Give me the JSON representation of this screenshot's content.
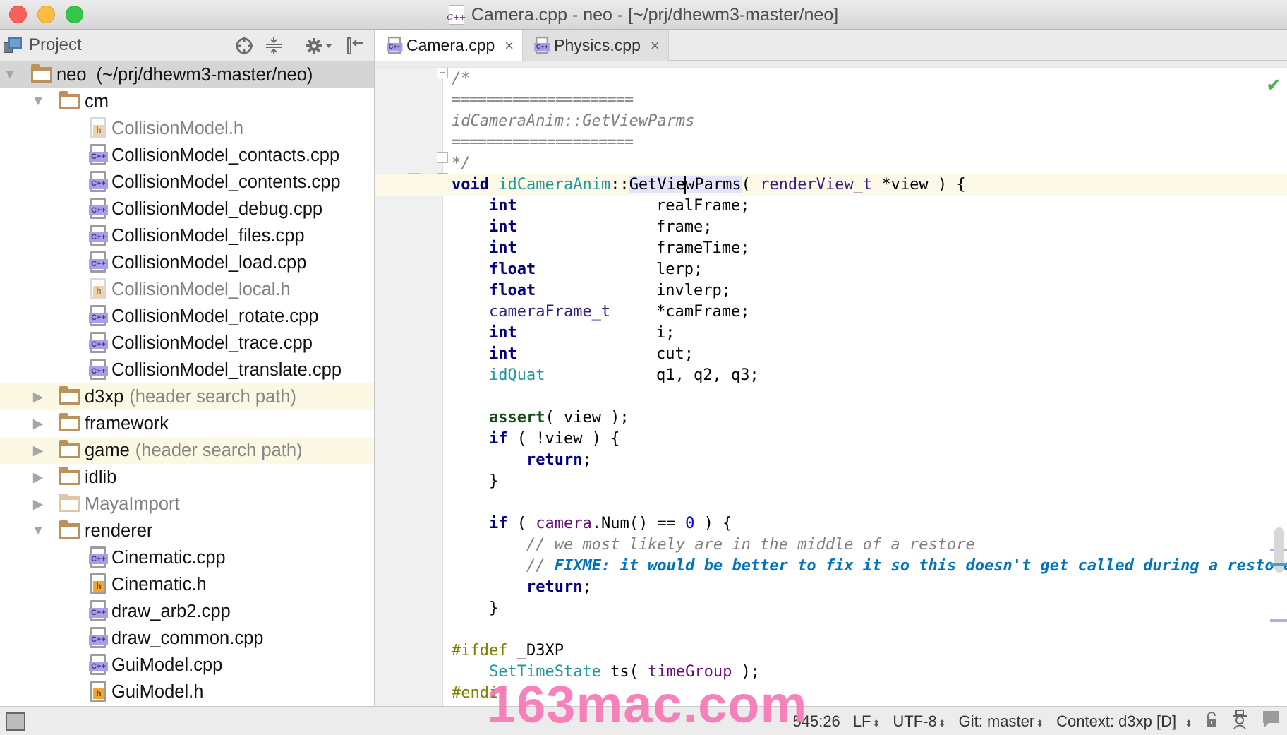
{
  "window": {
    "title": "Camera.cpp - neo - [~/prj/dhewm3-master/neo]",
    "title_icon": "cpp-file-icon"
  },
  "project_panel": {
    "title": "Project",
    "tools": [
      "locate-icon",
      "collapse-all-icon",
      "gear-icon",
      "hide-panel-icon"
    ],
    "tree": [
      {
        "label": "neo",
        "hint": "(~/prj/dhewm3-master/neo)",
        "type": "folder",
        "expanded": true,
        "selected": true
      },
      {
        "label": "cm",
        "type": "folder",
        "expanded": true
      },
      {
        "label": "CollisionModel.h",
        "type": "h",
        "dim": true
      },
      {
        "label": "CollisionModel_contacts.cpp",
        "type": "cpp"
      },
      {
        "label": "CollisionModel_contents.cpp",
        "type": "cpp"
      },
      {
        "label": "CollisionModel_debug.cpp",
        "type": "cpp"
      },
      {
        "label": "CollisionModel_files.cpp",
        "type": "cpp"
      },
      {
        "label": "CollisionModel_load.cpp",
        "type": "cpp"
      },
      {
        "label": "CollisionModel_local.h",
        "type": "h",
        "dim": true
      },
      {
        "label": "CollisionModel_rotate.cpp",
        "type": "cpp"
      },
      {
        "label": "CollisionModel_trace.cpp",
        "type": "cpp"
      },
      {
        "label": "CollisionModel_translate.cpp",
        "type": "cpp"
      },
      {
        "label": "d3xp",
        "hint": "(header search path)",
        "type": "folder",
        "expanded": false
      },
      {
        "label": "framework",
        "type": "folder",
        "expanded": false
      },
      {
        "label": "game",
        "hint": "(header search path)",
        "type": "folder",
        "expanded": false
      },
      {
        "label": "idlib",
        "type": "folder",
        "expanded": false
      },
      {
        "label": "MayaImport",
        "type": "folder",
        "expanded": false,
        "dim": true
      },
      {
        "label": "renderer",
        "type": "folder",
        "expanded": true
      },
      {
        "label": "Cinematic.cpp",
        "type": "cpp"
      },
      {
        "label": "Cinematic.h",
        "type": "h"
      },
      {
        "label": "draw_arb2.cpp",
        "type": "cpp"
      },
      {
        "label": "draw_common.cpp",
        "type": "cpp"
      },
      {
        "label": "GuiModel.cpp",
        "type": "cpp"
      },
      {
        "label": "GuiModel.h",
        "type": "h"
      }
    ]
  },
  "editor": {
    "tabs": [
      {
        "label": "Camera.cpp",
        "active": true,
        "close": "×"
      },
      {
        "label": "Physics.cpp",
        "active": false,
        "close": "×"
      }
    ],
    "code": {
      "c_open": "/*",
      "c_sep": "=====================",
      "c_name": "idCameraAnim::GetViewParms",
      "c_close": "*/",
      "sig_void": "void",
      "sig_class": "idCameraAnim",
      "sig_sep": "::",
      "sig_fn_a": "GetVie",
      "sig_fn_b": "wParms",
      "sig_paren": "( ",
      "sig_type": "renderView_t",
      "sig_rest": " *view ) {",
      "decls": [
        {
          "type": "int",
          "name": "realFrame;",
          "kind": "kw"
        },
        {
          "type": "int",
          "name": "frame;",
          "kind": "kw"
        },
        {
          "type": "int",
          "name": "frameTime;",
          "kind": "kw"
        },
        {
          "type": "float",
          "name": "lerp;",
          "kind": "kw"
        },
        {
          "type": "float",
          "name": "invlerp;",
          "kind": "kw"
        },
        {
          "type": "cameraFrame_t",
          "name": "*camFrame;",
          "kind": "typ"
        },
        {
          "type": "int",
          "name": "i;",
          "kind": "kw"
        },
        {
          "type": "int",
          "name": "cut;",
          "kind": "kw"
        },
        {
          "type": "idQuat",
          "name": "q1, q2, q3;",
          "kind": "cls"
        }
      ],
      "assert_fn": "assert",
      "assert_rest": "( view );",
      "if1_kw": "if",
      "if1_rest": " ( !view ) {",
      "return_kw": "return",
      "semi": ";",
      "close_brace": "}",
      "if2_kw": "if",
      "if2_a": " ( ",
      "if2_member": "camera",
      "if2_b": ".Num() == ",
      "if2_num": "0",
      "if2_c": " ) {",
      "comment1": "// we most likely are in the middle of a restore",
      "comment2_prefix": "// ",
      "comment2_todo": "FIXME: it would be better to fix it so this doesn't get called during a restore",
      "pp_ifdef": "#ifdef",
      "pp_macro": " _D3XP",
      "settime_class": "SetTimeState",
      "settime_a": " ts( ",
      "settime_member": "timeGroup",
      "settime_b": " );",
      "pp_endif": "#endif"
    },
    "inspection_status": "ok-check-icon"
  },
  "statusbar": {
    "position": "545:26",
    "line_separator": "LF",
    "encoding": "UTF-8",
    "vcs": "Git: master",
    "context": "Context: d3xp [D]",
    "updown": "⬍"
  },
  "watermark": "163mac.com",
  "colors": {
    "keyword": "#000080",
    "class": "#20999d",
    "type": "#371f80",
    "comment": "#808080",
    "todo": "#0073bf",
    "preprocessor": "#808000",
    "folder": "#bb925a",
    "current_line": "#fdf9e8"
  }
}
